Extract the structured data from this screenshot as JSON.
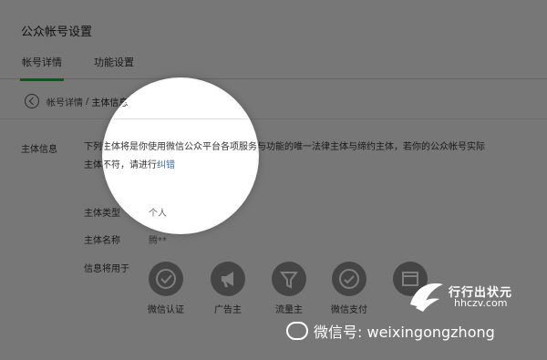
{
  "page": {
    "title": "公众帐号设置",
    "tabs": [
      "帐号详情",
      "功能设置"
    ],
    "breadcrumb": {
      "parent": "帐号详情",
      "sep": "/",
      "current": "主体信息"
    }
  },
  "subject": {
    "label": "主体信息",
    "desc_line1": "下列主体将是你使用微信公众平台各项服务与功能的唯一法律主体与缔约主体，若你的公众帐号实际",
    "desc_line2_pre": "主体不符，请进行",
    "desc_link": "纠错"
  },
  "fields": {
    "type_label": "主体类型",
    "type_value": "个人",
    "name_label": "主体名称",
    "name_value": "腾**",
    "usage_label": "信息将用于"
  },
  "usages": [
    {
      "name": "check-icon",
      "label": "微信认证"
    },
    {
      "name": "megaphone-icon",
      "label": "广告主"
    },
    {
      "name": "funnel-icon",
      "label": "流量主"
    },
    {
      "name": "wallet-icon",
      "label": "微信支付"
    },
    {
      "name": "store-icon",
      "label": ""
    }
  ],
  "watermarks": {
    "site_name": "行行出状元",
    "site_url": "hhczv.com",
    "wechat_id": "微信号: weixingongzhong"
  }
}
